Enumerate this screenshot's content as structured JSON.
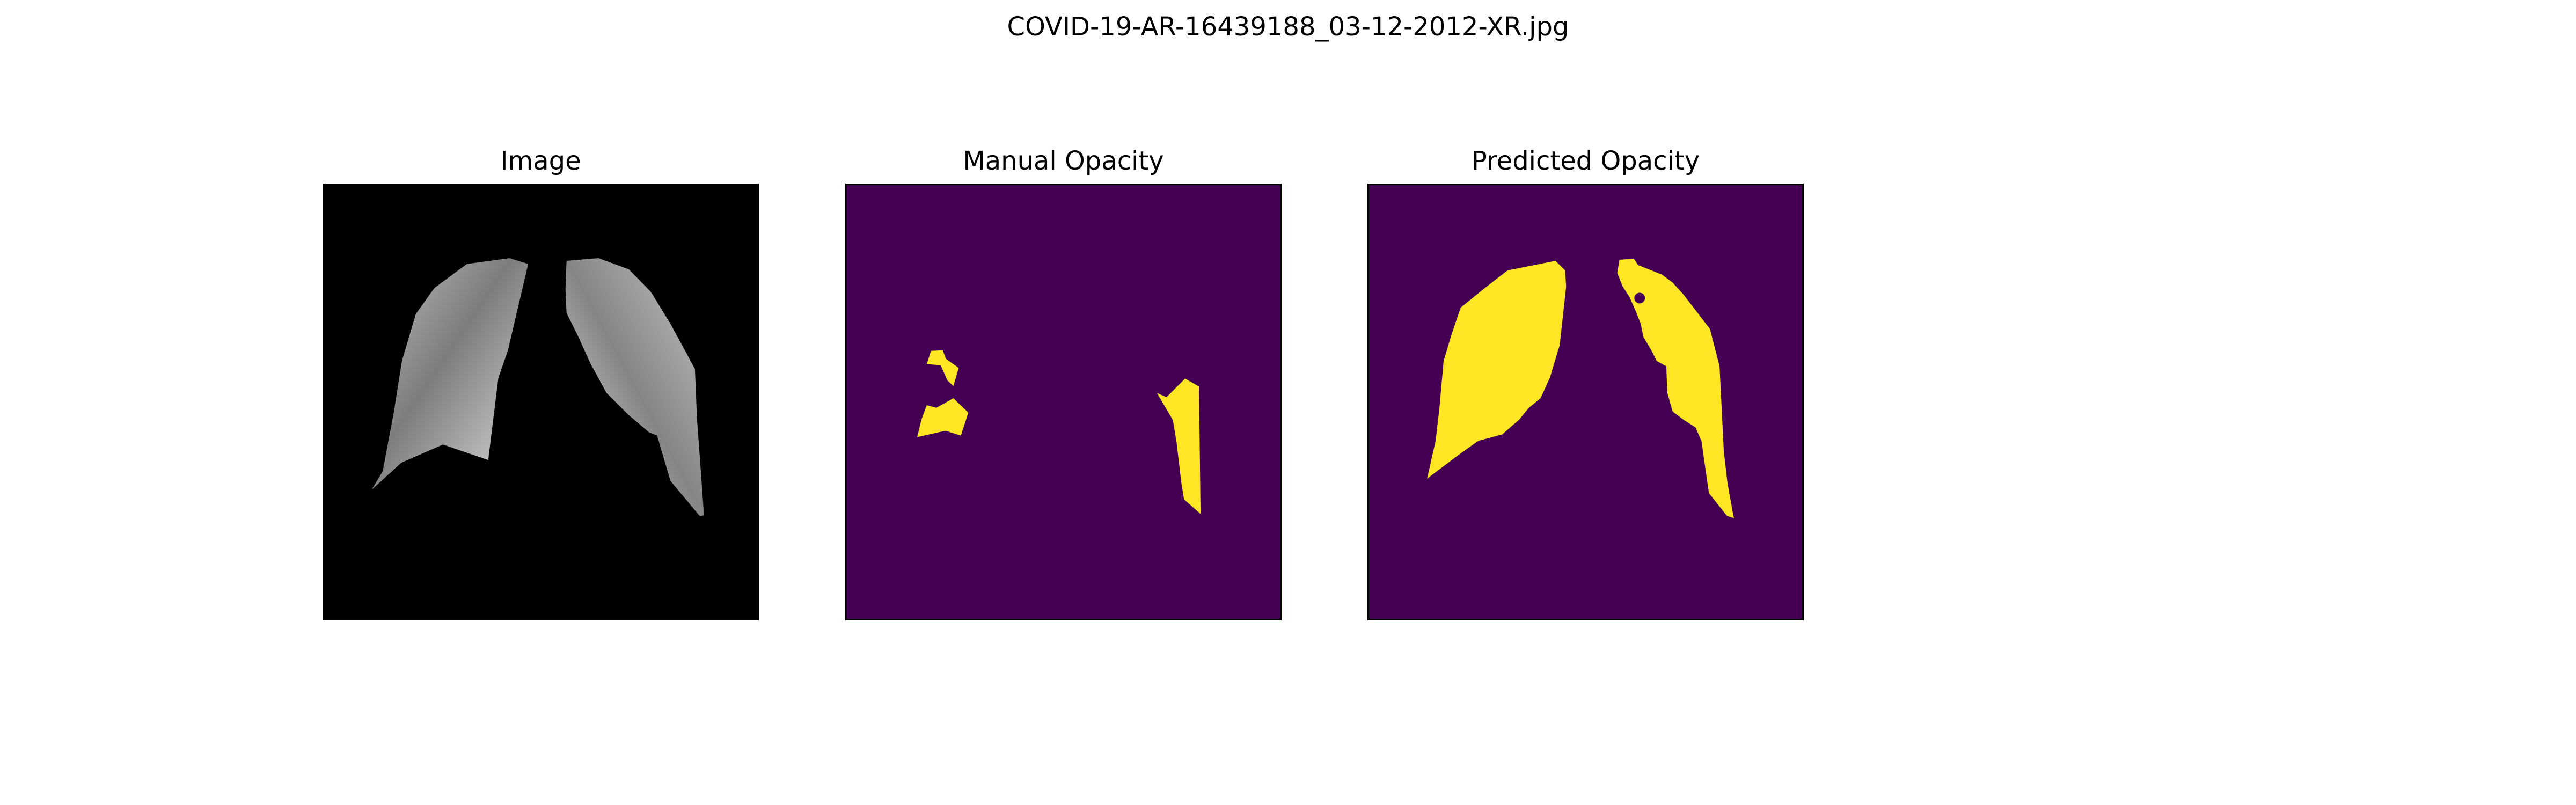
{
  "figure": {
    "title": "COVID-19-AR-16439188_03-12-2012-XR.jpg"
  },
  "panels": [
    {
      "title": "Image"
    },
    {
      "title": "Manual Opacity"
    },
    {
      "title": "Predicted Opacity"
    }
  ],
  "colors": {
    "image_background": "#000000",
    "mask_background": "#440154",
    "mask_foreground": "#fde725"
  }
}
